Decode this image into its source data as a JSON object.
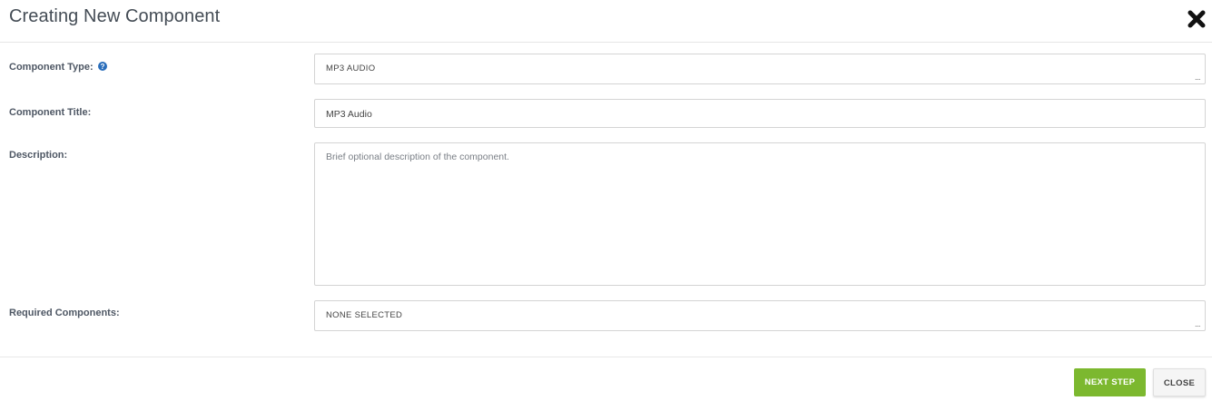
{
  "modal": {
    "title": "Creating New Component",
    "close_icon": "close-x-icon"
  },
  "form": {
    "component_type": {
      "label": "Component Type:",
      "help_icon": "question-circle-icon",
      "value": "MP3 AUDIO",
      "picker_glyph": "..."
    },
    "component_title": {
      "label": "Component Title:",
      "value": "MP3 Audio"
    },
    "description": {
      "label": "Description:",
      "value": "",
      "placeholder": "Brief optional description of the component."
    },
    "required_components": {
      "label": "Required Components:",
      "value": "NONE SELECTED",
      "picker_glyph": "..."
    }
  },
  "footer": {
    "next_label": "NEXT STEP",
    "close_label": "CLOSE"
  },
  "colors": {
    "primary_green": "#7cb82f",
    "help_blue": "#2a6ebb"
  }
}
